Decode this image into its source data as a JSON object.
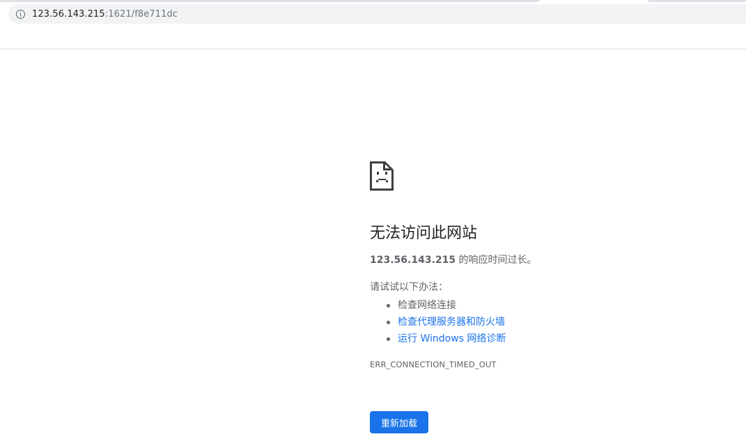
{
  "address_bar": {
    "host": "123.56.143.215",
    "rest": ":1621/f8e711dc"
  },
  "error": {
    "heading": "无法访问此网站",
    "summary_host": "123.56.143.215",
    "summary_text": " 的响应时间过长。",
    "try_label": "请试试以下办法：",
    "suggestions": [
      {
        "label": "检查网络连接",
        "is_link": false
      },
      {
        "label": "检查代理服务器和防火墙",
        "is_link": true
      },
      {
        "label": "运行 Windows 网络诊断",
        "is_link": true
      }
    ],
    "code": "ERR_CONNECTION_TIMED_OUT",
    "reload_label": "重新加载"
  },
  "icons": {
    "site_info": "info-icon",
    "page": "sad-page-icon"
  },
  "colors": {
    "link": "#1a73e8",
    "button": "#1a73e8",
    "text": "#202124",
    "secondary_text": "#5f6368"
  }
}
